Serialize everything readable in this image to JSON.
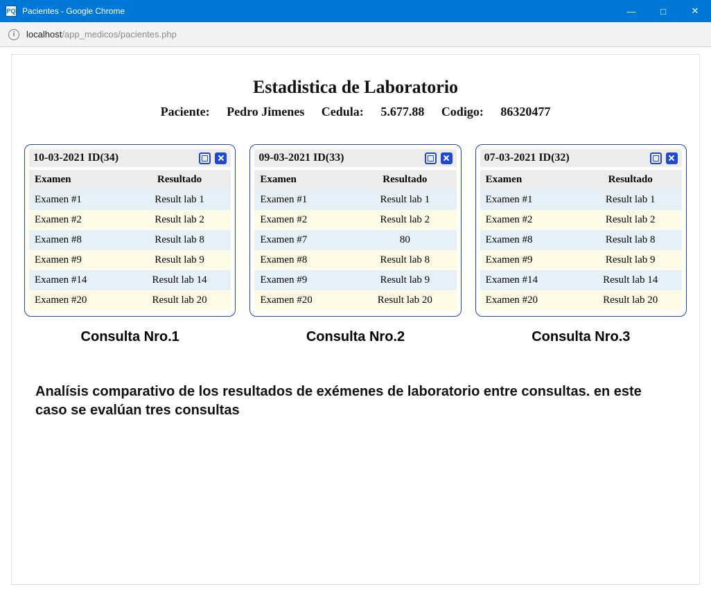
{
  "window": {
    "title": "Pacientes - Google Chrome",
    "favicon_label": "PQ"
  },
  "address": {
    "host": "localhost",
    "path": "/app_medicos/pacientes.php"
  },
  "page": {
    "heading": "Estadistica de Laboratorio",
    "patient_label": "Paciente:",
    "patient_name": "Pedro Jimenes",
    "cedula_label": "Cedula:",
    "cedula_value": "5.677.88",
    "codigo_label": "Codigo:",
    "codigo_value": "86320477",
    "columns": {
      "exam": "Examen",
      "result": "Resultado"
    },
    "analysis_text": "Analísis comparativo de los resultados de exémenes de laboratorio entre consultas. en este caso se evalúan tres consultas"
  },
  "consultas": [
    {
      "header": "10-03-2021 ID(34)",
      "caption": "Consulta Nro.1",
      "rows": [
        {
          "exam": "Examen #1",
          "result": "Result lab 1"
        },
        {
          "exam": "Examen #2",
          "result": "Result lab 2"
        },
        {
          "exam": "Examen #8",
          "result": "Result lab 8"
        },
        {
          "exam": "Examen #9",
          "result": "Result lab 9"
        },
        {
          "exam": "Examen #14",
          "result": "Result lab 14"
        },
        {
          "exam": "Examen #20",
          "result": "Result lab 20"
        }
      ]
    },
    {
      "header": "09-03-2021 ID(33)",
      "caption": "Consulta Nro.2",
      "rows": [
        {
          "exam": "Examen #1",
          "result": "Result lab 1"
        },
        {
          "exam": "Examen #2",
          "result": "Result lab 2"
        },
        {
          "exam": "Examen #7",
          "result": "80"
        },
        {
          "exam": "Examen #8",
          "result": "Result lab 8"
        },
        {
          "exam": "Examen #9",
          "result": "Result lab 9"
        },
        {
          "exam": "Examen #20",
          "result": "Result lab 20"
        }
      ]
    },
    {
      "header": "07-03-2021 ID(32)",
      "caption": "Consulta Nro.3",
      "rows": [
        {
          "exam": "Examen #1",
          "result": "Result lab 1"
        },
        {
          "exam": "Examen #2",
          "result": "Result lab 2"
        },
        {
          "exam": "Examen #8",
          "result": "Result lab 8"
        },
        {
          "exam": "Examen #9",
          "result": "Result lab 9"
        },
        {
          "exam": "Examen #14",
          "result": "Result lab 14"
        },
        {
          "exam": "Examen #20",
          "result": "Result lab 20"
        }
      ]
    }
  ]
}
